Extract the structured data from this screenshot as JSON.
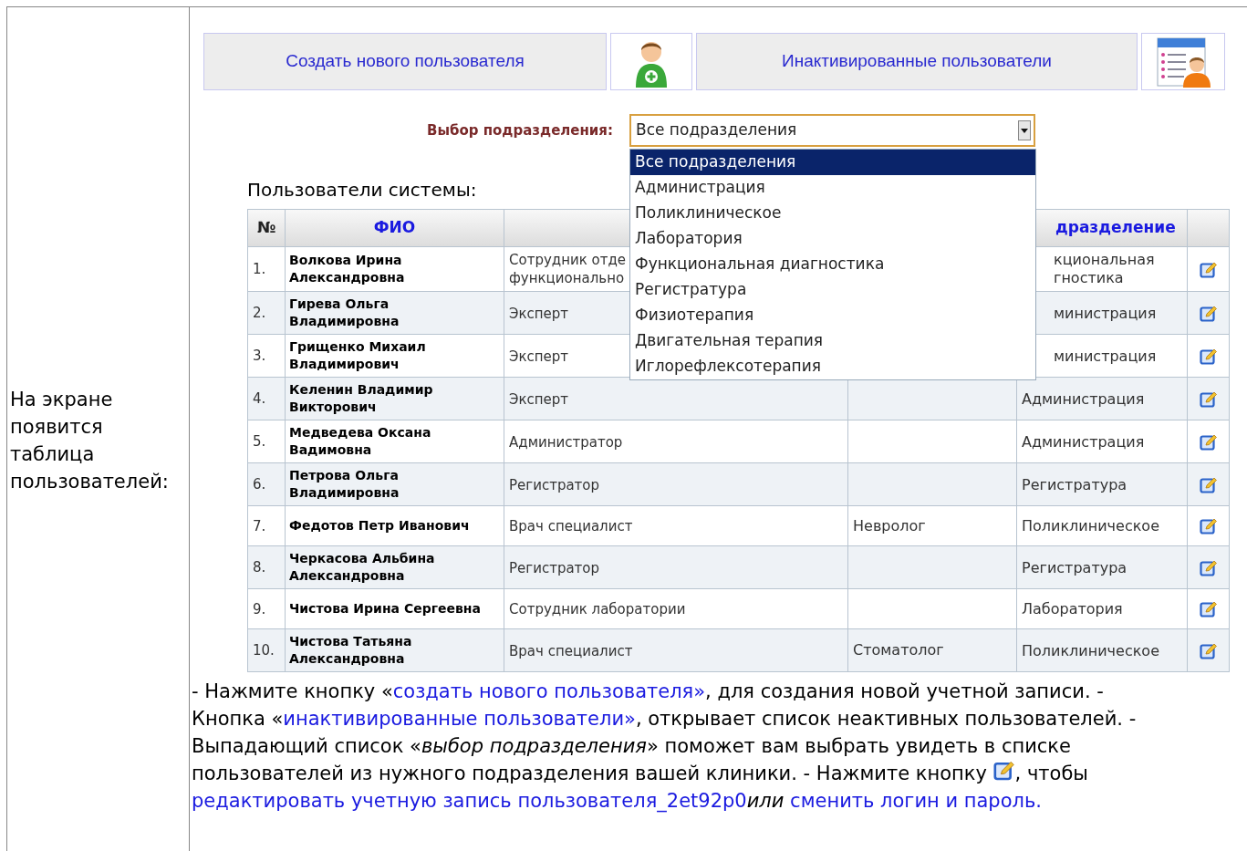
{
  "left_cell": {
    "text": "На экране появится таблица пользователей:"
  },
  "toolbar": {
    "create_button": "Создать нового пользователя",
    "inactive_button": "Инактивированные пользователи"
  },
  "department_filter": {
    "label": "Выбор подразделения:",
    "value": "Все подразделения",
    "expanded": true,
    "options": [
      {
        "label": "Все подразделения",
        "selected": true
      },
      {
        "label": "Администрация",
        "selected": false
      },
      {
        "label": "Поликлиническое",
        "selected": false
      },
      {
        "label": "Лаборатория",
        "selected": false
      },
      {
        "label": "Функциональная диагностика",
        "selected": false
      },
      {
        "label": "Регистратура",
        "selected": false
      },
      {
        "label": "Физиотерапия",
        "selected": false
      },
      {
        "label": "Двигательная терапия",
        "selected": false
      },
      {
        "label": "Иглорефлексотерапия",
        "selected": false
      }
    ]
  },
  "users_title": "Пользователи системы:",
  "table": {
    "columns": [
      "№",
      "ФИО",
      "",
      "",
      "дразделение",
      ""
    ],
    "rows": [
      {
        "num": "1.",
        "name": "Волкова Ирина Александровна",
        "role": [
          "Сотрудник отде",
          "функционально"
        ],
        "specialty": "",
        "department": [
          "кциональная",
          "гностика"
        ]
      },
      {
        "num": "2.",
        "name": "Гирева Ольга Владимировна",
        "role": [
          "Эксперт"
        ],
        "specialty": "",
        "department": [
          "министрация"
        ]
      },
      {
        "num": "3.",
        "name": "Грищенко Михаил Владимирович",
        "role": [
          "Эксперт"
        ],
        "specialty": "",
        "department": [
          "министрация"
        ]
      },
      {
        "num": "4.",
        "name": "Келенин Владимир Викторович",
        "role": [
          "Эксперт"
        ],
        "specialty": "",
        "department": [
          "Администрация"
        ]
      },
      {
        "num": "5.",
        "name": "Медведева Оксана Вадимовна",
        "role": [
          "Администратор"
        ],
        "specialty": "",
        "department": [
          "Администрация"
        ]
      },
      {
        "num": "6.",
        "name": "Петрова Ольга Владимировна",
        "role": [
          "Регистратор"
        ],
        "specialty": "",
        "department": [
          "Регистратура"
        ]
      },
      {
        "num": "7.",
        "name": "Федотов Петр Иванович",
        "role": [
          "Врач специалист"
        ],
        "specialty": "Невролог",
        "department": [
          "Поликлиническое"
        ]
      },
      {
        "num": "8.",
        "name": "Черкасова Альбина Александровна",
        "role": [
          "Регистратор"
        ],
        "specialty": "",
        "department": [
          "Регистратура"
        ]
      },
      {
        "num": "9.",
        "name": "Чистова Ирина Сергеевна",
        "role": [
          "Сотрудник лаборатории"
        ],
        "specialty": "",
        "department": [
          "Лаборатория"
        ]
      },
      {
        "num": "10.",
        "name": "Чистова Татьяна Александровна",
        "role": [
          "Врач специалист"
        ],
        "specialty": "Стоматолог",
        "department": [
          "Поликлиническое"
        ]
      }
    ]
  },
  "note": [
    {
      "kind": "text",
      "text": "- Нажмите кнопку «"
    },
    {
      "kind": "link",
      "text": "создать нового пользователя»"
    },
    {
      "kind": "text",
      "text": ", для создания новой учетной записи. - Кнопка «"
    },
    {
      "kind": "link",
      "text": "инактивированные пользователи»"
    },
    {
      "kind": "text",
      "text": ", открывает список неактивных пользователей. - Выпадающий список «"
    },
    {
      "kind": "italic",
      "text": "выбор подразделения"
    },
    {
      "kind": "text",
      "text": "» поможет вам выбрать увидеть в списке пользователей из нужного подразделения вашей клиники. - Нажмите кнопку "
    },
    {
      "kind": "icon"
    },
    {
      "kind": "text",
      "text": ", чтобы "
    },
    {
      "kind": "link",
      "text": "редактировать учетную запись пользователя_2et92p0"
    },
    {
      "kind": "italic",
      "text": "или "
    },
    {
      "kind": "link",
      "text": "сменить логин и пароль."
    }
  ]
}
